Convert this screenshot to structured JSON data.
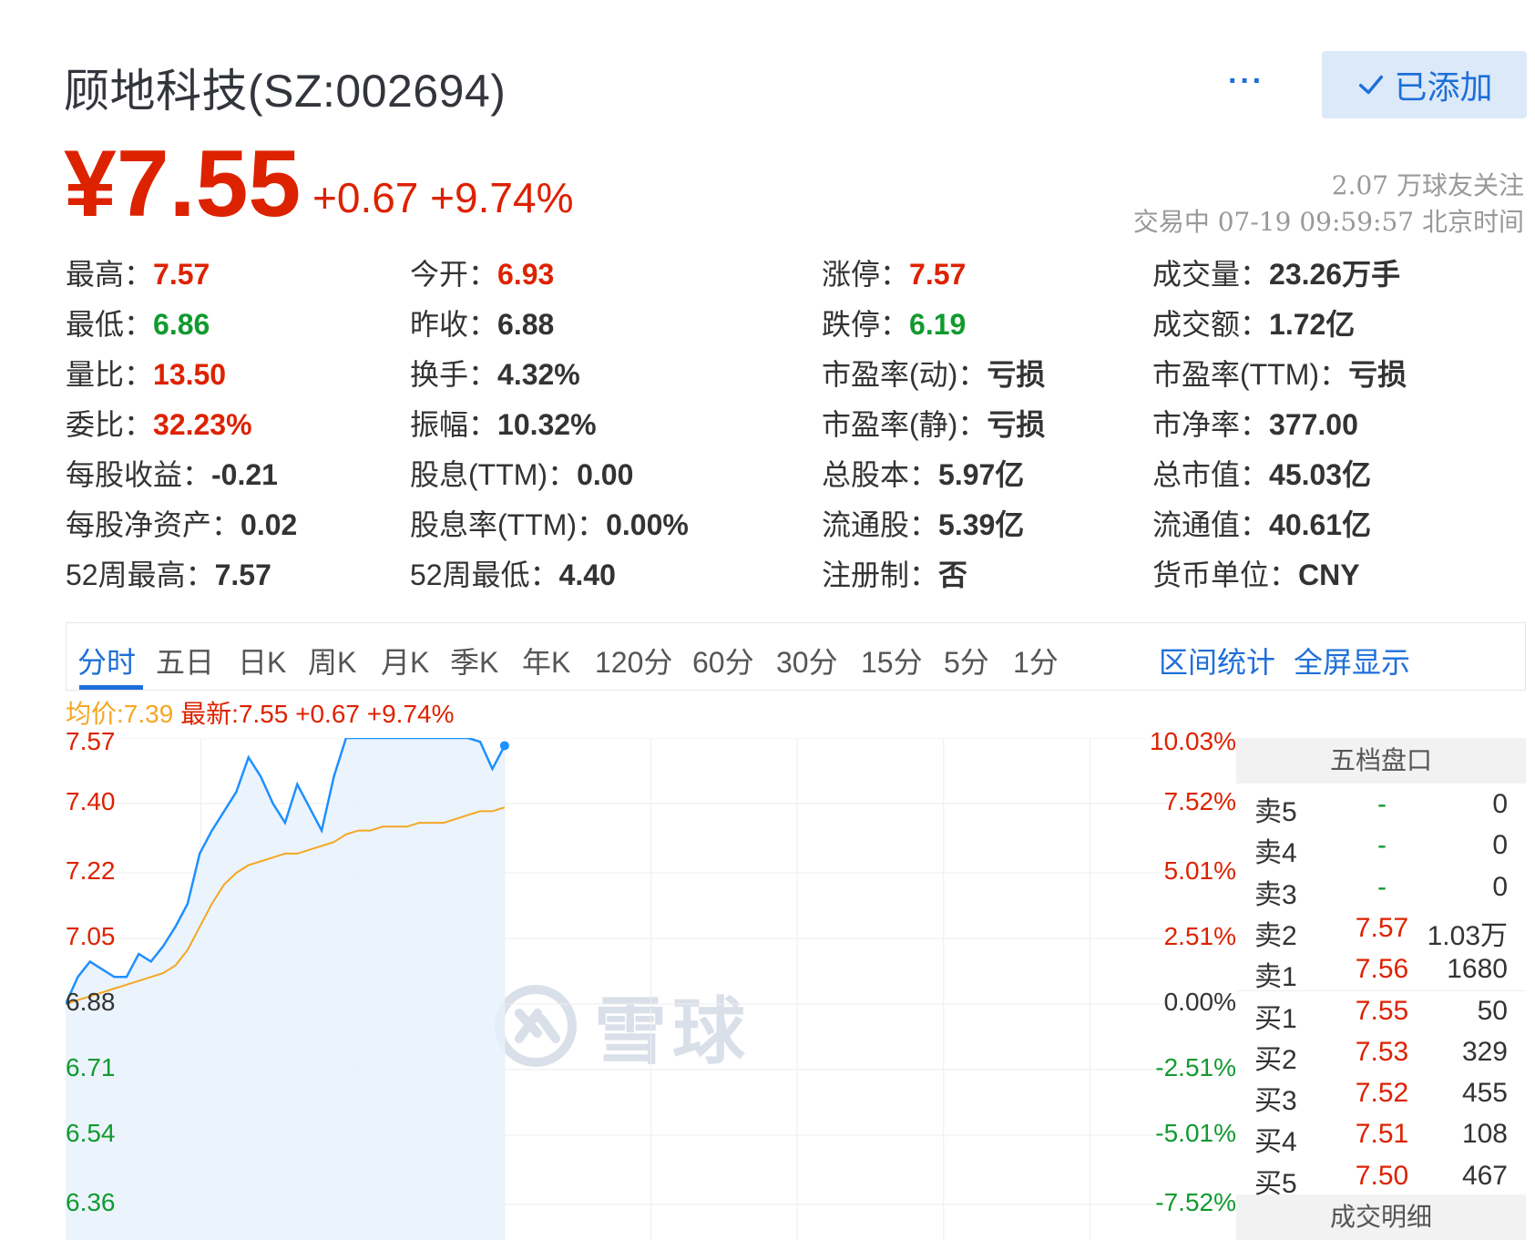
{
  "header": {
    "title": "顾地科技(SZ:002694)",
    "more_label": "···",
    "follow_label": "已添加"
  },
  "price": {
    "current": "¥7.55",
    "change": "+0.67 +9.74%",
    "followers": "2.07 万球友关注",
    "status": "交易中 07-19 09:59:57 北京时间"
  },
  "quote": [
    [
      {
        "label": "最高：",
        "value": "7.57",
        "color": "red"
      },
      {
        "label": "今开：",
        "value": "6.93",
        "color": "red"
      },
      {
        "label": "涨停：",
        "value": "7.57",
        "color": "red"
      },
      {
        "label": "成交量：",
        "value": "23.26万手",
        "color": ""
      }
    ],
    [
      {
        "label": "最低：",
        "value": "6.86",
        "color": "green"
      },
      {
        "label": "昨收：",
        "value": "6.88",
        "color": ""
      },
      {
        "label": "跌停：",
        "value": "6.19",
        "color": "green"
      },
      {
        "label": "成交额：",
        "value": "1.72亿",
        "color": ""
      }
    ],
    [
      {
        "label": "量比：",
        "value": "13.50",
        "color": "red"
      },
      {
        "label": "换手：",
        "value": "4.32%",
        "color": ""
      },
      {
        "label": "市盈率(动)：",
        "value": "亏损",
        "color": ""
      },
      {
        "label": "市盈率(TTM)：",
        "value": "亏损",
        "color": ""
      }
    ],
    [
      {
        "label": "委比：",
        "value": "32.23%",
        "color": "red"
      },
      {
        "label": "振幅：",
        "value": "10.32%",
        "color": ""
      },
      {
        "label": "市盈率(静)：",
        "value": "亏损",
        "color": ""
      },
      {
        "label": "市净率：",
        "value": "377.00",
        "color": ""
      }
    ],
    [
      {
        "label": "每股收益：",
        "value": "-0.21",
        "color": ""
      },
      {
        "label": "股息(TTM)：",
        "value": "0.00",
        "color": ""
      },
      {
        "label": "总股本：",
        "value": "5.97亿",
        "color": ""
      },
      {
        "label": "总市值：",
        "value": "45.03亿",
        "color": ""
      }
    ],
    [
      {
        "label": "每股净资产：",
        "value": "0.02",
        "color": ""
      },
      {
        "label": "股息率(TTM)：",
        "value": "0.00%",
        "color": ""
      },
      {
        "label": "流通股：",
        "value": "5.39亿",
        "color": ""
      },
      {
        "label": "流通值：",
        "value": "40.61亿",
        "color": ""
      }
    ],
    [
      {
        "label": "52周最高：",
        "value": "7.57",
        "color": ""
      },
      {
        "label": "52周最低：",
        "value": "4.40",
        "color": ""
      },
      {
        "label": "注册制：",
        "value": "否",
        "color": ""
      },
      {
        "label": "货币单位：",
        "value": "CNY",
        "color": ""
      }
    ]
  ],
  "tabs": {
    "items": [
      "分时",
      "五日",
      "日K",
      "周K",
      "月K",
      "季K",
      "年K",
      "120分",
      "60分",
      "30分",
      "15分",
      "5分",
      "1分"
    ],
    "active": 0,
    "right": [
      "区间统计",
      "全屏显示"
    ]
  },
  "legend": {
    "avg": "均价:7.39",
    "latest": "最新:7.55 +0.67 +9.74%"
  },
  "watermark": "雪球",
  "colors": {
    "up": "#dd2200",
    "down": "#119a2f",
    "accent": "#1e6fd9",
    "avg_line": "#f5a623",
    "price_line": "#1e90ff"
  },
  "chart_data": {
    "type": "line",
    "y_left_ticks": [
      "7.57",
      "7.40",
      "7.22",
      "7.05",
      "6.88",
      "6.71",
      "6.54",
      "6.36"
    ],
    "y_right_ticks": [
      "10.03%",
      "7.52%",
      "5.01%",
      "2.51%",
      "0.00%",
      "-2.51%",
      "-5.01%",
      "-7.52%"
    ],
    "ylim": [
      6.36,
      7.57
    ],
    "x_total_minutes": 240,
    "series": [
      {
        "name": "最新",
        "values": [
          6.88,
          6.95,
          6.99,
          6.97,
          6.95,
          6.95,
          7.01,
          6.99,
          7.03,
          7.08,
          7.14,
          7.27,
          7.33,
          7.38,
          7.43,
          7.52,
          7.47,
          7.4,
          7.35,
          7.45,
          7.39,
          7.33,
          7.47,
          7.57,
          7.57,
          7.57,
          7.57,
          7.57,
          7.57,
          7.57,
          7.57,
          7.57,
          7.57,
          7.57,
          7.56,
          7.49,
          7.55
        ]
      },
      {
        "name": "均价",
        "values": [
          6.88,
          6.89,
          6.9,
          6.91,
          6.92,
          6.93,
          6.94,
          6.95,
          6.96,
          6.98,
          7.02,
          7.08,
          7.14,
          7.19,
          7.22,
          7.24,
          7.25,
          7.26,
          7.27,
          7.27,
          7.28,
          7.29,
          7.3,
          7.32,
          7.33,
          7.33,
          7.34,
          7.34,
          7.34,
          7.35,
          7.35,
          7.35,
          7.36,
          7.37,
          7.38,
          7.38,
          7.39
        ]
      }
    ]
  },
  "order_book": {
    "title": "五档盘口",
    "footer": "成交明细",
    "rows": [
      {
        "label": "卖5",
        "price": "-",
        "volume": "0",
        "color": "green"
      },
      {
        "label": "卖4",
        "price": "-",
        "volume": "0",
        "color": "green"
      },
      {
        "label": "卖3",
        "price": "-",
        "volume": "0",
        "color": "green"
      },
      {
        "label": "卖2",
        "price": "7.57",
        "volume": "1.03万",
        "color": "red"
      },
      {
        "label": "卖1",
        "price": "7.56",
        "volume": "1680",
        "color": "red"
      },
      {
        "label": "买1",
        "price": "7.55",
        "volume": "50",
        "color": "red"
      },
      {
        "label": "买2",
        "price": "7.53",
        "volume": "329",
        "color": "red"
      },
      {
        "label": "买3",
        "price": "7.52",
        "volume": "455",
        "color": "red"
      },
      {
        "label": "买4",
        "price": "7.51",
        "volume": "108",
        "color": "red"
      },
      {
        "label": "买5",
        "price": "7.50",
        "volume": "467",
        "color": "red"
      }
    ]
  }
}
